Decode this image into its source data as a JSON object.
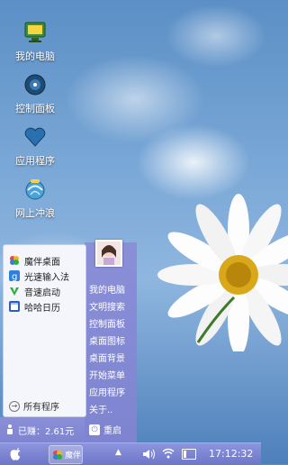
{
  "desktop": {
    "icons": [
      {
        "label": "我的电脑",
        "icon": "computer-icon"
      },
      {
        "label": "控制面板",
        "icon": "control-panel-icon"
      },
      {
        "label": "应用程序",
        "icon": "heart-app-icon"
      },
      {
        "label": "网上冲浪",
        "icon": "internet-globe-icon"
      }
    ]
  },
  "start_menu": {
    "programs": [
      {
        "label": "魔伴桌面",
        "icon": "pinwheel-icon",
        "color": "#e9453a"
      },
      {
        "label": "光速输入法",
        "icon": "input-method-icon",
        "color": "#2f7fe0"
      },
      {
        "label": "音速启动",
        "icon": "v-launcher-icon",
        "color": "#2eae3c"
      },
      {
        "label": "哈哈日历",
        "icon": "calendar-icon",
        "color": "#2d5fb8"
      }
    ],
    "all_programs": "所有程序",
    "right_items": [
      "我的电脑",
      "文明搜索",
      "控制面板",
      "桌面图标",
      "桌面背景",
      "开始菜单",
      "应用程序",
      "关于.."
    ],
    "earned": "已赚：2.61元",
    "restart": "重启"
  },
  "taskbar": {
    "app_label": "魔伴",
    "clock": "17:12:32",
    "tray_arrow": "▲"
  },
  "colors": {
    "menu_purple": "#7e84cf",
    "taskbar_purple": "#6d76c8"
  }
}
